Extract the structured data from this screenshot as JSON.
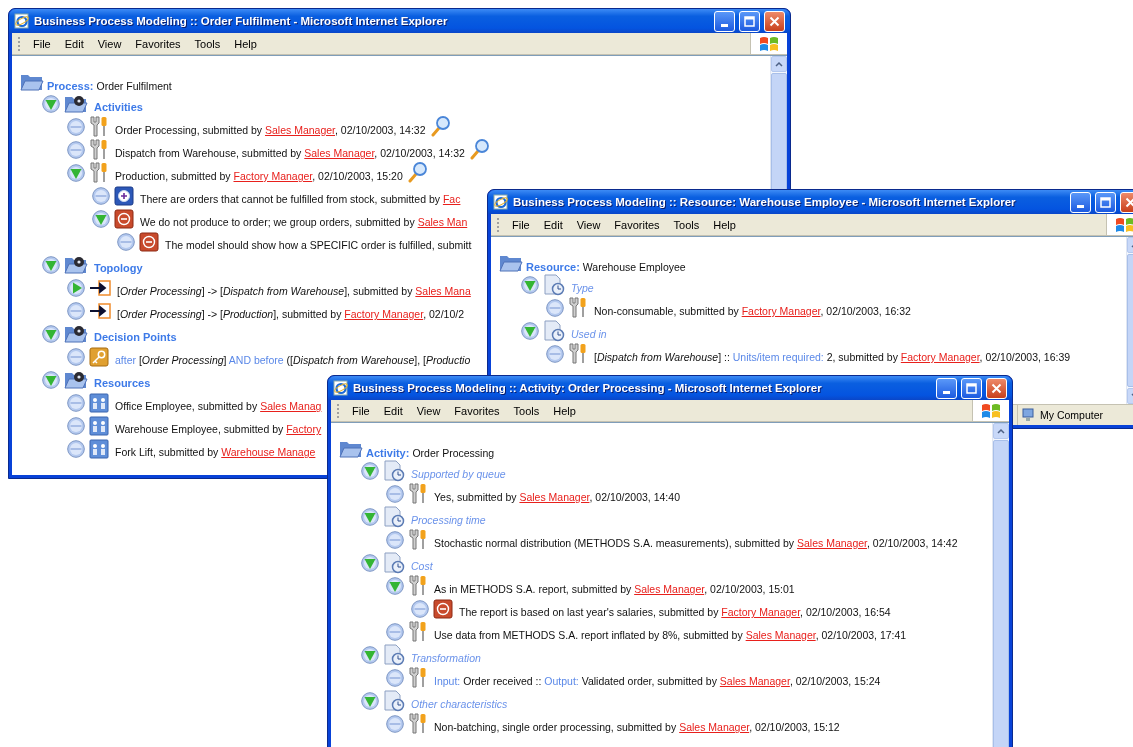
{
  "windows": [
    {
      "title": "Business Process Modeling :: Order Fulfilment - Microsoft Internet Explorer",
      "menu": [
        "File",
        "Edit",
        "View",
        "Favorites",
        "Tools",
        "Help"
      ],
      "root": {
        "label": "Process:",
        "name": "Order Fulfilment"
      },
      "tree": [
        {
          "expanded": true,
          "empty": false,
          "kind": "group",
          "title": "Activities",
          "children": [
            {
              "empty": true,
              "kind": "tool",
              "zoom": true,
              "text": [
                {
                  "kind": "plain",
                  "t": "Order Processing, submitted by "
                },
                {
                  "kind": "link",
                  "t": "Sales Manager"
                },
                {
                  "kind": "plain",
                  "t": ", 02/10/2003, 14:32"
                }
              ]
            },
            {
              "empty": true,
              "kind": "tool",
              "zoom": true,
              "text": [
                {
                  "kind": "plain",
                  "t": "Dispatch from Warehouse, submitted by "
                },
                {
                  "kind": "link",
                  "t": "Sales Manager"
                },
                {
                  "kind": "plain",
                  "t": ", 02/10/2003, 14:32"
                }
              ]
            },
            {
              "expanded": true,
              "empty": false,
              "kind": "tool",
              "zoom": true,
              "text": [
                {
                  "kind": "plain",
                  "t": "Production, submitted by "
                },
                {
                  "kind": "link",
                  "t": "Factory Manager"
                },
                {
                  "kind": "plain",
                  "t": ", 02/10/2003, 15:20"
                }
              ],
              "children": [
                {
                  "empty": true,
                  "kind": "pro",
                  "text": [
                    {
                      "kind": "plain",
                      "t": "There are orders that cannot be fulfilled from stock, submitted by "
                    },
                    {
                      "kind": "link",
                      "t": "Fac"
                    }
                  ]
                },
                {
                  "expanded": true,
                  "empty": false,
                  "kind": "con",
                  "text": [
                    {
                      "kind": "plain",
                      "t": "We do not produce to order; we group orders, submitted by "
                    },
                    {
                      "kind": "link",
                      "t": "Sales Man"
                    }
                  ],
                  "children": [
                    {
                      "empty": true,
                      "kind": "con",
                      "text": [
                        {
                          "kind": "plain",
                          "t": "The model should show how a SPECIFIC order is fulfilled, submitt"
                        }
                      ]
                    }
                  ]
                }
              ]
            }
          ]
        },
        {
          "expanded": true,
          "empty": false,
          "kind": "group",
          "title": "Topology",
          "children": [
            {
              "expanded": false,
              "empty": false,
              "kind": "flow",
              "text": [
                {
                  "kind": "plain",
                  "t": "[*Order Processing*] -> [*Dispatch from Warehouse*], submitted by "
                },
                {
                  "kind": "link",
                  "t": "Sales Mana"
                }
              ]
            },
            {
              "empty": true,
              "kind": "flow",
              "text": [
                {
                  "kind": "plain",
                  "t": "[*Order Processing*] -> [*Production*], submitted by "
                },
                {
                  "kind": "link",
                  "t": "Factory Manager"
                },
                {
                  "kind": "plain",
                  "t": ", 02/10/2"
                }
              ]
            }
          ]
        },
        {
          "expanded": true,
          "empty": false,
          "kind": "group",
          "title": "Decision Points",
          "children": [
            {
              "empty": true,
              "kind": "key",
              "text": [
                {
                  "kind": "label",
                  "t": "after"
                },
                {
                  "kind": "plain",
                  "t": " [*Order Processing*] "
                },
                {
                  "kind": "label",
                  "t": "AND before"
                },
                {
                  "kind": "plain",
                  "t": " ([*Dispatch from Warehouse*], [*Productio*"
                }
              ]
            }
          ]
        },
        {
          "expanded": true,
          "empty": false,
          "kind": "group",
          "title": "Resources",
          "children": [
            {
              "empty": true,
              "kind": "resource",
              "text": [
                {
                  "kind": "plain",
                  "t": "Office Employee, submitted by "
                },
                {
                  "kind": "link",
                  "t": "Sales Manag"
                }
              ]
            },
            {
              "empty": true,
              "kind": "resource",
              "text": [
                {
                  "kind": "plain",
                  "t": "Warehouse Employee, submitted by "
                },
                {
                  "kind": "link",
                  "t": "Factory"
                }
              ]
            },
            {
              "empty": true,
              "kind": "resource",
              "text": [
                {
                  "kind": "plain",
                  "t": "Fork Lift, submitted by "
                },
                {
                  "kind": "link",
                  "t": "Warehouse Manage"
                }
              ]
            }
          ]
        }
      ]
    },
    {
      "title": "Business Process Modeling :: Resource: Warehouse Employee - Microsoft Internet Explorer",
      "menu": [
        "File",
        "Edit",
        "View",
        "Favorites",
        "Tools",
        "Help"
      ],
      "root": {
        "label": "Resource:",
        "name": "Warehouse Employee"
      },
      "tree": [
        {
          "expanded": true,
          "empty": false,
          "kind": "attribute",
          "title": "Type",
          "children": [
            {
              "empty": true,
              "kind": "tool",
              "text": [
                {
                  "kind": "plain",
                  "t": "Non-consumable, submitted by "
                },
                {
                  "kind": "link",
                  "t": "Factory Manager"
                },
                {
                  "kind": "plain",
                  "t": ", 02/10/2003, 16:32"
                }
              ]
            }
          ]
        },
        {
          "expanded": true,
          "empty": false,
          "kind": "attribute",
          "title": "Used in",
          "children": [
            {
              "empty": true,
              "kind": "tool",
              "text": [
                {
                  "kind": "plain",
                  "t": "[*Dispatch from Warehouse*] :: "
                },
                {
                  "kind": "label",
                  "t": "Units/item required:"
                },
                {
                  "kind": "plain",
                  "t": " 2, submitted by "
                },
                {
                  "kind": "link",
                  "t": "Factory Manager"
                },
                {
                  "kind": "plain",
                  "t": ", 02/10/2003, 16:39"
                }
              ]
            }
          ]
        }
      ],
      "status": "My Computer"
    },
    {
      "title": "Business Process Modeling :: Activity: Order Processing - Microsoft Internet Explorer",
      "menu": [
        "File",
        "Edit",
        "View",
        "Favorites",
        "Tools",
        "Help"
      ],
      "root": {
        "label": "Activity:",
        "name": "Order Processing"
      },
      "tree": [
        {
          "expanded": true,
          "empty": false,
          "kind": "attribute",
          "title": "Supported by queue",
          "children": [
            {
              "empty": true,
              "kind": "tool",
              "text": [
                {
                  "kind": "plain",
                  "t": "Yes, submitted by "
                },
                {
                  "kind": "link",
                  "t": "Sales Manager"
                },
                {
                  "kind": "plain",
                  "t": ", 02/10/2003, 14:40"
                }
              ]
            }
          ]
        },
        {
          "expanded": true,
          "empty": false,
          "kind": "attribute",
          "title": "Processing time",
          "children": [
            {
              "empty": true,
              "kind": "tool",
              "text": [
                {
                  "kind": "plain",
                  "t": "Stochastic normal distribution (METHODS S.A. measurements), submitted by "
                },
                {
                  "kind": "link",
                  "t": "Sales Manager"
                },
                {
                  "kind": "plain",
                  "t": ", 02/10/2003, 14:42"
                }
              ]
            }
          ]
        },
        {
          "expanded": true,
          "empty": false,
          "kind": "attribute",
          "title": "Cost",
          "children": [
            {
              "expanded": true,
              "empty": false,
              "kind": "tool",
              "text": [
                {
                  "kind": "plain",
                  "t": "As in METHODS S.A. report, submitted by "
                },
                {
                  "kind": "link",
                  "t": "Sales Manager"
                },
                {
                  "kind": "plain",
                  "t": ", 02/10/2003, 15:01"
                }
              ],
              "children": [
                {
                  "empty": true,
                  "kind": "con",
                  "text": [
                    {
                      "kind": "plain",
                      "t": "The report is based on last year's salaries, submitted by "
                    },
                    {
                      "kind": "link",
                      "t": "Factory Manager"
                    },
                    {
                      "kind": "plain",
                      "t": ", 02/10/2003, 16:54"
                    }
                  ]
                }
              ]
            },
            {
              "empty": true,
              "kind": "tool",
              "text": [
                {
                  "kind": "plain",
                  "t": "Use data from METHODS S.A. report inflated by 8%, submitted by "
                },
                {
                  "kind": "link",
                  "t": "Sales Manager"
                },
                {
                  "kind": "plain",
                  "t": ", 02/10/2003, 17:41"
                }
              ]
            }
          ]
        },
        {
          "expanded": true,
          "empty": false,
          "kind": "attribute",
          "title": "Transformation",
          "children": [
            {
              "empty": true,
              "kind": "tool",
              "text": [
                {
                  "kind": "label",
                  "t": "Input:"
                },
                {
                  "kind": "plain",
                  "t": " Order received :: "
                },
                {
                  "kind": "label",
                  "t": "Output:"
                },
                {
                  "kind": "plain",
                  "t": " Validated order, submitted by "
                },
                {
                  "kind": "link",
                  "t": "Sales Manager"
                },
                {
                  "kind": "plain",
                  "t": ", 02/10/2003, 15:24"
                }
              ]
            }
          ]
        },
        {
          "expanded": true,
          "empty": false,
          "kind": "attribute",
          "title": "Other characteristics",
          "children": [
            {
              "empty": true,
              "kind": "tool",
              "text": [
                {
                  "kind": "plain",
                  "t": "Non-batching, single order processing, submitted by "
                },
                {
                  "kind": "link",
                  "t": "Sales Manager"
                },
                {
                  "kind": "plain",
                  "t": ", 02/10/2003, 15:12"
                }
              ]
            }
          ]
        }
      ]
    }
  ]
}
